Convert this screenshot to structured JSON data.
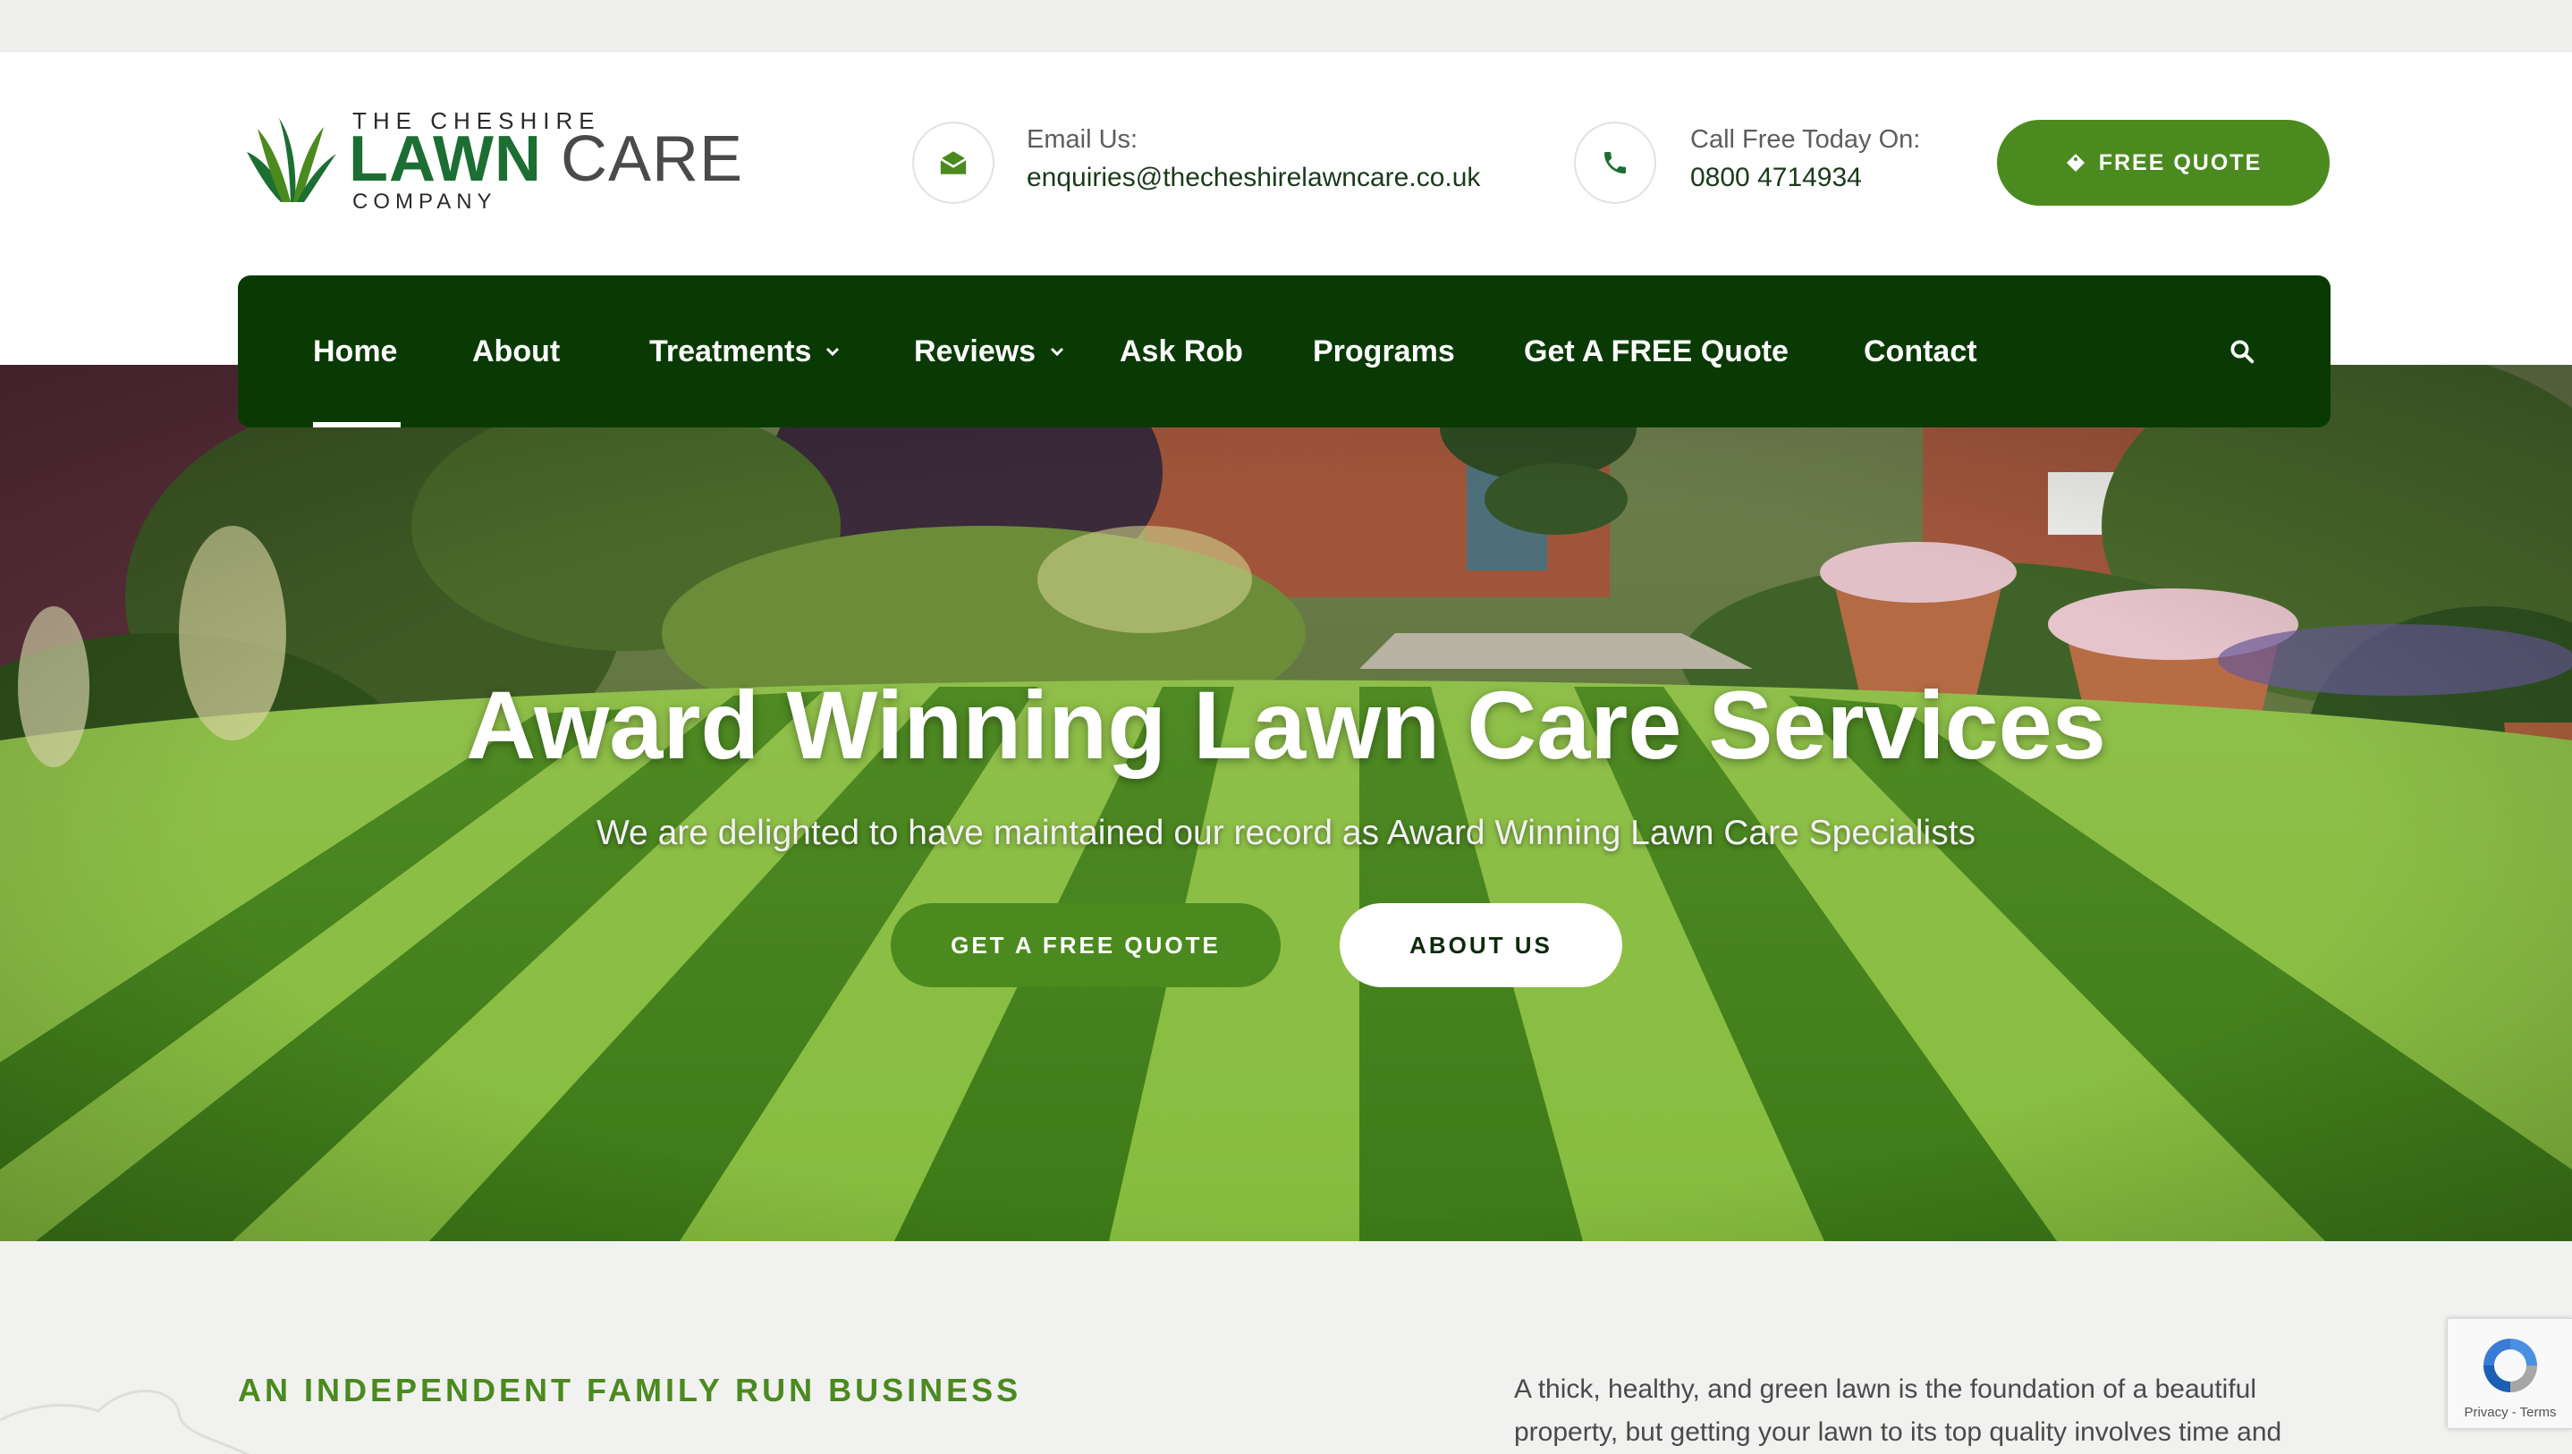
{
  "logo": {
    "top": "THE CHESHIRE",
    "lawn": "LAWN",
    "care": "CARE",
    "bottom": "COMPANY"
  },
  "header": {
    "email_label": "Email Us:",
    "email_value": "enquiries@thecheshirelawncare.co.uk",
    "phone_label": "Call Free Today On:",
    "phone_value": "0800 4714934",
    "quote_button": "FREE QUOTE"
  },
  "nav": {
    "items": [
      {
        "label": "Home"
      },
      {
        "label": "About"
      },
      {
        "label": "Treatments"
      },
      {
        "label": "Reviews"
      },
      {
        "label": "Ask Rob"
      },
      {
        "label": "Programs"
      },
      {
        "label": "Get A FREE Quote"
      },
      {
        "label": "Contact"
      }
    ],
    "active": "Home"
  },
  "hero": {
    "title": "Award Winning Lawn Care Services",
    "subtitle": "We are delighted to have maintained our record as Award Winning Lawn Care Specialists",
    "primary_button": "GET A FREE QUOTE",
    "secondary_button": "ABOUT US"
  },
  "intro": {
    "kicker": "AN INDEPENDENT FAMILY RUN BUSINESS",
    "text": "A thick, healthy, and green lawn is the foundation of a beautiful property, but getting your lawn to its top quality involves time and"
  },
  "recaptcha": {
    "text": "Privacy - Terms"
  },
  "colors": {
    "brand_green": "#4b8a1f",
    "nav_green": "#0a3a03",
    "logo_green": "#1c6e33"
  },
  "icons": {
    "email": "envelope-icon",
    "phone": "phone-icon",
    "quote": "tag-icon",
    "dropdown": "chevron-down-icon",
    "search": "search-icon",
    "recaptcha": "recaptcha-icon"
  }
}
